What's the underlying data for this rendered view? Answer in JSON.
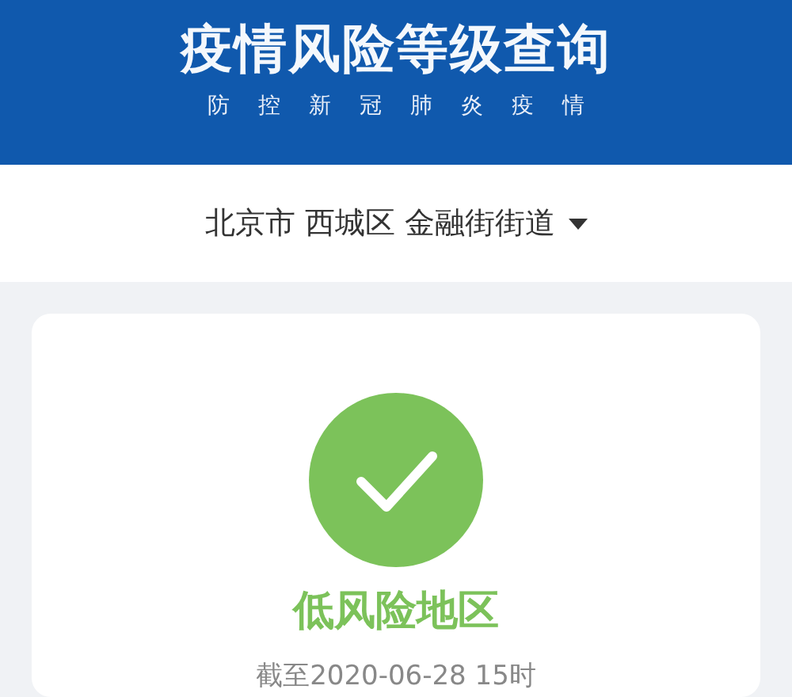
{
  "header": {
    "title": "疫情风险等级查询",
    "subtitle": "防控新冠肺炎疫情"
  },
  "location": {
    "label": "北京市 西城区 金融街街道",
    "expanded": false
  },
  "result": {
    "kind": "low",
    "label": "低风险地区",
    "updated": "截至2020-06-28 15时"
  }
}
